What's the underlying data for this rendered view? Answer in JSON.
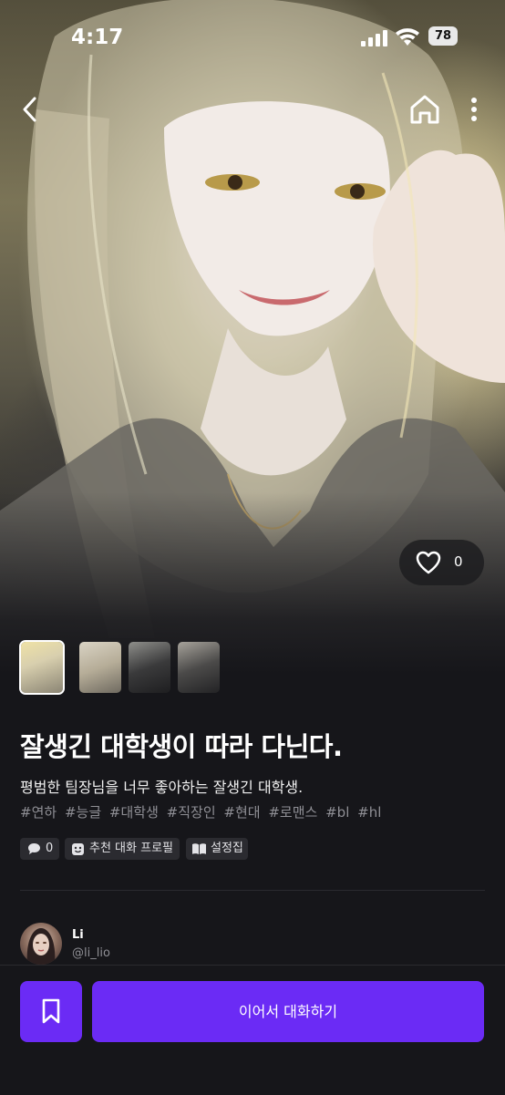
{
  "status_bar": {
    "time": "4:17",
    "battery": "78"
  },
  "nav": {
    "back_icon": "chevron-left-icon",
    "home_icon": "home-icon",
    "more_icon": "more-vertical-icon"
  },
  "likes": {
    "count": "0",
    "icon": "heart-outline-icon"
  },
  "character": {
    "title": "잘생긴 대학생이 따라 다닌다.",
    "description": "평범한 팀장님을 너무 좋아하는 잘생긴 대학생.",
    "tags": [
      "#연하",
      "#능글",
      "#대학생",
      "#직장인",
      "#현대",
      "#로맨스",
      "#bl",
      "#hl"
    ]
  },
  "chips": {
    "comments": {
      "icon": "comment-icon",
      "label": "0"
    },
    "profile": {
      "icon": "profile-icon",
      "label": "추천 대화 프로필"
    },
    "settings": {
      "icon": "book-icon",
      "label": "설정집"
    }
  },
  "author": {
    "name": "Li",
    "handle": "@li_lio"
  },
  "actions": {
    "bookmark_icon": "bookmark-icon",
    "continue_label": "이어서 대화하기"
  },
  "colors": {
    "accent": "#6b2bf5",
    "background": "#16161a"
  }
}
